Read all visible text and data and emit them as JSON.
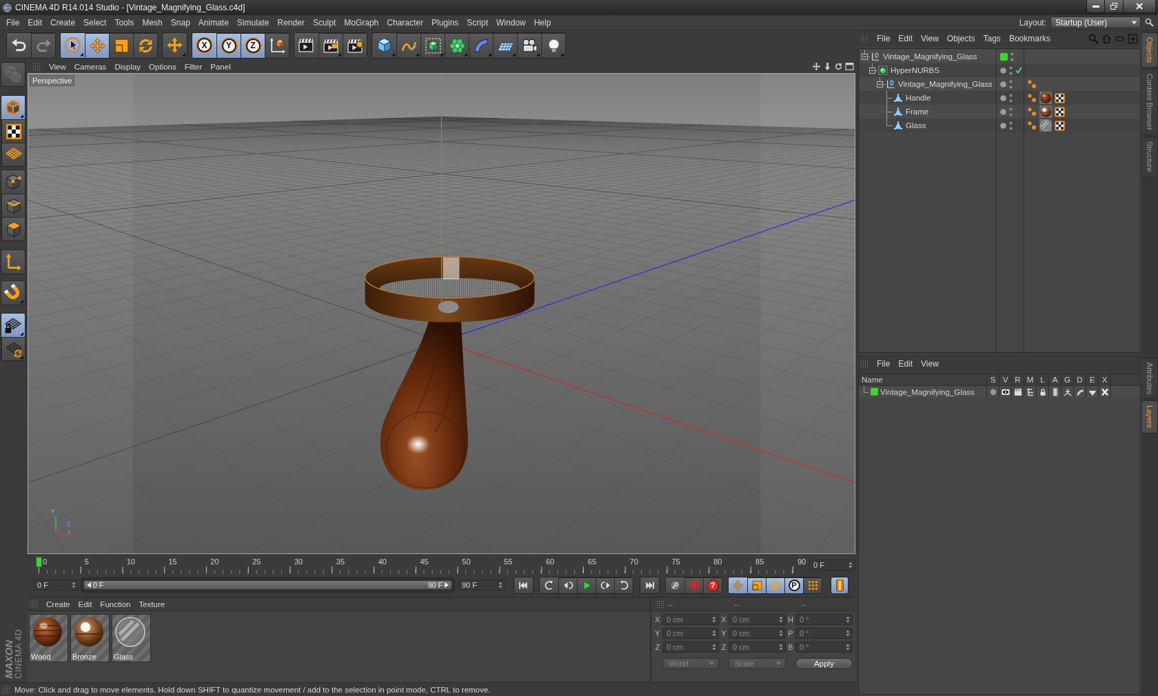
{
  "window": {
    "title": "CINEMA 4D R14.014 Studio - [Vintage_Magnifying_Glass.c4d]"
  },
  "menu": [
    "File",
    "Edit",
    "Create",
    "Select",
    "Tools",
    "Mesh",
    "Snap",
    "Animate",
    "Simulate",
    "Render",
    "Sculpt",
    "MoGraph",
    "Character",
    "Plugins",
    "Script",
    "Window",
    "Help"
  ],
  "layout": {
    "label": "Layout:",
    "value": "Startup (User)"
  },
  "toolbar": [
    {
      "buttons": [
        {
          "kind": "undo",
          "disabled": false
        },
        {
          "kind": "redo",
          "disabled": true
        }
      ]
    },
    {
      "buttons": [
        {
          "kind": "select",
          "selected": true,
          "submenu": true
        },
        {
          "kind": "move",
          "selected": true,
          "submenu": false
        },
        {
          "kind": "scale",
          "selected": false,
          "submenu": false
        },
        {
          "kind": "rotate",
          "selected": false,
          "submenu": false
        }
      ]
    },
    {
      "buttons": [
        {
          "kind": "recent",
          "selected": false,
          "submenu": true
        }
      ]
    },
    {
      "buttons": [
        {
          "kind": "axis",
          "label": "X",
          "selected": true
        },
        {
          "kind": "axis",
          "label": "Y",
          "selected": true
        },
        {
          "kind": "axis",
          "label": "Z",
          "selected": true
        },
        {
          "kind": "coordinates",
          "selected": false
        }
      ]
    },
    {
      "buttons": [
        {
          "kind": "render-view",
          "submenu": false
        },
        {
          "kind": "render-picture",
          "submenu": true
        },
        {
          "kind": "render-settings",
          "submenu": false
        }
      ]
    },
    {
      "buttons": [
        {
          "kind": "cube",
          "submenu": true
        },
        {
          "kind": "spline",
          "submenu": true
        },
        {
          "kind": "subdivision",
          "submenu": true
        },
        {
          "kind": "array",
          "submenu": true
        },
        {
          "kind": "deformer",
          "submenu": true
        },
        {
          "kind": "floor",
          "submenu": true
        },
        {
          "kind": "camera",
          "submenu": true
        },
        {
          "kind": "light",
          "submenu": true
        }
      ]
    }
  ],
  "left_toolbar": [
    {
      "buttons": [
        {
          "kind": "make-editable",
          "disabled": true,
          "submenu": false
        }
      ]
    },
    {
      "buttons": [
        {
          "kind": "model",
          "selected": true,
          "submenu": true
        },
        {
          "kind": "texture",
          "selected": false,
          "submenu": false
        },
        {
          "kind": "workplane",
          "selected": false,
          "submenu": false
        }
      ]
    },
    {
      "buttons": [
        {
          "kind": "points",
          "selected": false,
          "submenu": false
        },
        {
          "kind": "edges",
          "selected": false,
          "submenu": false
        },
        {
          "kind": "polygons",
          "selected": false,
          "submenu": false
        }
      ]
    },
    {
      "buttons": [
        {
          "kind": "axis-mode",
          "selected": false,
          "submenu": false
        }
      ]
    },
    {
      "buttons": [
        {
          "kind": "magnet",
          "selected": false,
          "submenu": true
        }
      ]
    },
    {
      "buttons": [
        {
          "kind": "workplane-lock",
          "selected": true,
          "submenu": true
        },
        {
          "kind": "workplane-rotate",
          "selected": false,
          "submenu": true
        }
      ]
    }
  ],
  "viewport": {
    "menu": [
      "View",
      "Cameras",
      "Display",
      "Options",
      "Filter",
      "Panel"
    ],
    "camera": "Perspective",
    "axis_labels": [
      "Y",
      "Z",
      "X"
    ]
  },
  "timeline": {
    "ticks": [
      "0",
      "5",
      "10",
      "15",
      "20",
      "25",
      "30",
      "35",
      "40",
      "45",
      "50",
      "55",
      "60",
      "65",
      "70",
      "75",
      "80",
      "85",
      "90"
    ],
    "playhead": {
      "level": 0
    },
    "frame": "0 F"
  },
  "playback": {
    "start": "0 F",
    "range": {
      "from": "0 F",
      "to": "90 F",
      "level": 1
    },
    "end": "90 F",
    "groups": [
      {
        "buttons": [
          {
            "kind": "go-start"
          }
        ]
      },
      {
        "buttons": [
          {
            "kind": "prev-key"
          },
          {
            "kind": "prev-frame"
          },
          {
            "kind": "play"
          },
          {
            "kind": "next-frame"
          },
          {
            "kind": "next-key"
          }
        ]
      },
      {
        "buttons": [
          {
            "kind": "go-end"
          }
        ]
      },
      {
        "buttons": [
          {
            "kind": "autokey"
          },
          {
            "kind": "record"
          },
          {
            "kind": "help",
            "label": "?"
          }
        ]
      },
      {
        "buttons": [
          {
            "kind": "key-position",
            "selected": true
          },
          {
            "kind": "key-scale",
            "selected": true
          },
          {
            "kind": "key-rotation",
            "selected": true
          },
          {
            "kind": "key-parameter",
            "label": "P",
            "selected": true
          },
          {
            "kind": "key-points",
            "selected": false
          }
        ]
      },
      {
        "buttons": [
          {
            "kind": "timeline",
            "selected": true
          }
        ]
      }
    ]
  },
  "materials": {
    "menu": [
      "Create",
      "Edit",
      "Function",
      "Texture"
    ],
    "items": [
      {
        "name": "Wood",
        "kind": "wood"
      },
      {
        "name": "Bronze",
        "kind": "bronze"
      },
      {
        "name": "Glass",
        "kind": "glass"
      }
    ]
  },
  "coordinates": {
    "headers": [
      "--",
      "--",
      "--"
    ],
    "rows": [
      {
        "fields": [
          {
            "axis": "X",
            "value": "0 cm"
          },
          {
            "axis": "X",
            "value": "0 cm"
          },
          {
            "axis": "H",
            "value": "0 °"
          }
        ]
      },
      {
        "fields": [
          {
            "axis": "Y",
            "value": "0 cm"
          },
          {
            "axis": "Y",
            "value": "0 cm"
          },
          {
            "axis": "P",
            "value": "0 °"
          }
        ]
      },
      {
        "fields": [
          {
            "axis": "Z",
            "value": "0 cm"
          },
          {
            "axis": "Z",
            "value": "0 cm"
          },
          {
            "axis": "B",
            "value": "0 °"
          }
        ]
      }
    ],
    "dropdowns": [
      {
        "label": "World",
        "disabled": true
      },
      {
        "label": "Scale",
        "disabled": true
      }
    ],
    "apply": "Apply"
  },
  "status_bar": "Move: Click and drag to move elements. Hold down SHIFT to quantize movement / add to the selection in point mode, CTRL to remove.",
  "logo": {
    "brand": "MAXON",
    "product": "CINEMA 4D"
  },
  "objects": {
    "menu": [
      "File",
      "Edit",
      "View",
      "Objects",
      "Tags",
      "Bookmarks"
    ],
    "tree": [
      {
        "name": "Vintage_Magnifying_Glass",
        "kind": "null",
        "color": "#3fd42a",
        "expanded": true,
        "children": [
          {
            "name": "HyperNURBS",
            "kind": "subdivision",
            "enabled": true,
            "expanded": true,
            "children": [
              {
                "name": "Vintage_Magnifying_Glass",
                "kind": "null",
                "expanded": true,
                "tags": [
                  {
                    "kind": "phong"
                  }
                ],
                "children": [
                  {
                    "name": "Handle",
                    "kind": "polygon",
                    "tags": [
                      {
                        "kind": "phong"
                      },
                      {
                        "kind": "wood"
                      },
                      {
                        "kind": "uvw"
                      }
                    ]
                  },
                  {
                    "name": "Frame",
                    "kind": "polygon",
                    "tags": [
                      {
                        "kind": "phong"
                      },
                      {
                        "kind": "bronze"
                      },
                      {
                        "kind": "uvw"
                      }
                    ]
                  },
                  {
                    "name": "Glass",
                    "kind": "polygon",
                    "tags": [
                      {
                        "kind": "phong"
                      },
                      {
                        "kind": "glass"
                      },
                      {
                        "kind": "uvw"
                      }
                    ]
                  }
                ]
              }
            ]
          }
        ]
      }
    ]
  },
  "layers": {
    "menu": [
      "File",
      "Edit",
      "View"
    ],
    "columns": [
      "Name",
      "S",
      "V",
      "R",
      "M",
      "L",
      "A",
      "G",
      "D",
      "E",
      "X"
    ],
    "rows": [
      {
        "name": "Vintage_Magnifying_Glass",
        "color": "#3fd42a"
      }
    ]
  },
  "side_tabs": {
    "top": [
      {
        "label": "Objects",
        "selected": true
      },
      {
        "label": "Content Browser",
        "selected": false
      },
      {
        "label": "Structure",
        "selected": false
      }
    ],
    "bottom": [
      {
        "label": "Attributes",
        "selected": false
      },
      {
        "label": "Layers",
        "selected": true
      }
    ]
  }
}
